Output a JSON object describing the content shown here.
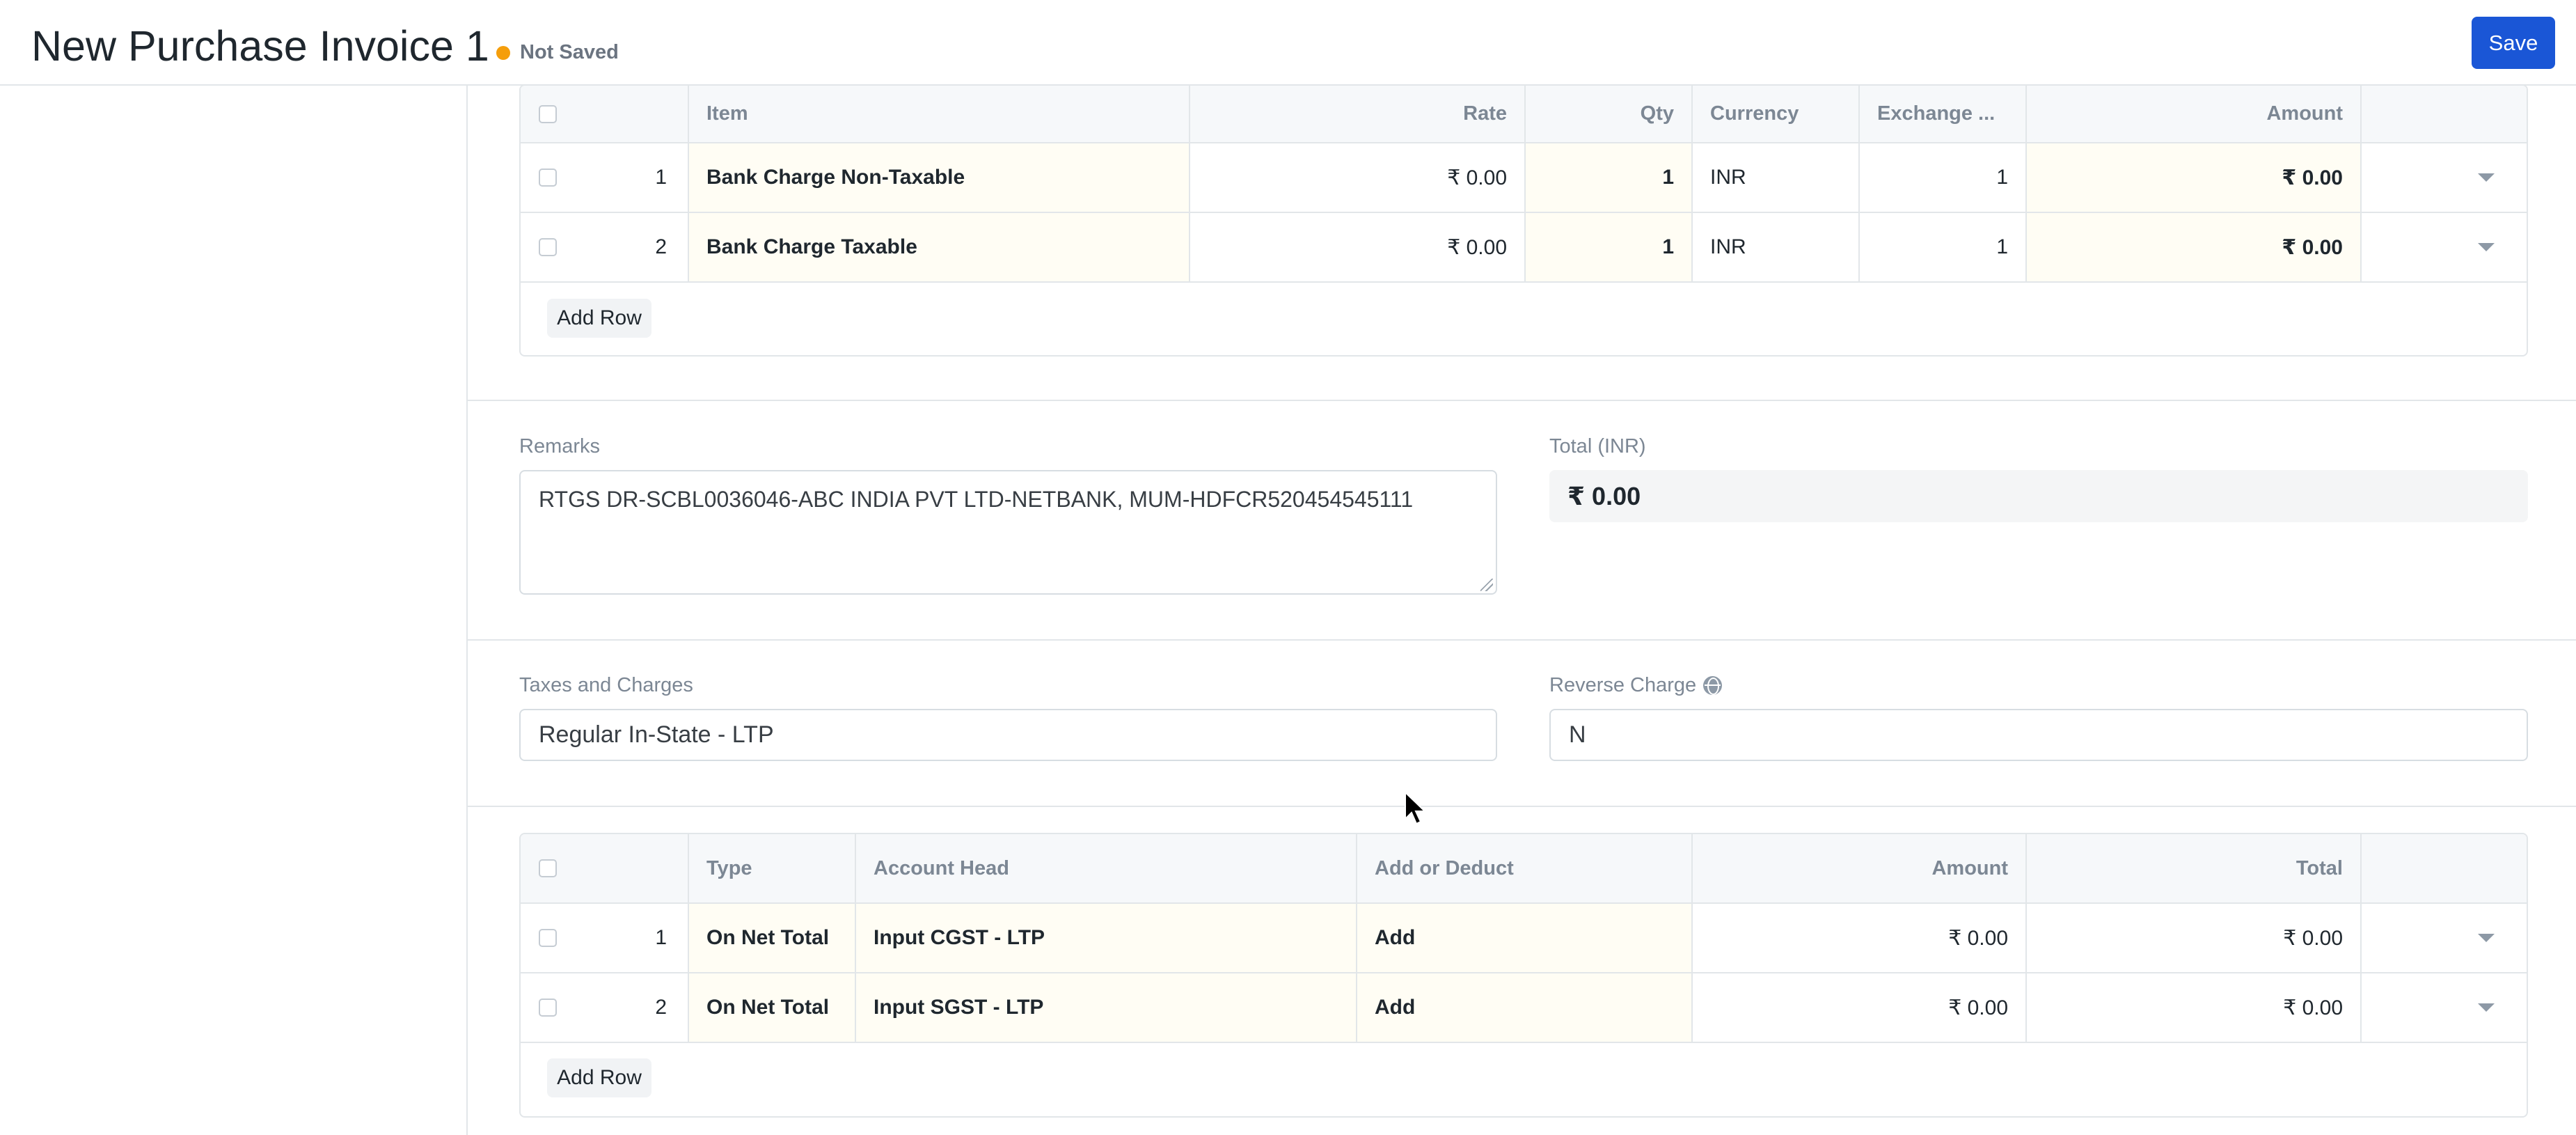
{
  "header": {
    "title": "New Purchase Invoice 1",
    "status": "Not Saved",
    "save_label": "Save"
  },
  "items_table": {
    "columns": [
      "Item",
      "Rate",
      "Qty",
      "Currency",
      "Exchange ...",
      "Amount"
    ],
    "rows": [
      {
        "idx": "1",
        "item": "Bank Charge Non-Taxable",
        "rate": "₹ 0.00",
        "qty": "1",
        "currency": "INR",
        "exchange": "1",
        "amount": "₹ 0.00"
      },
      {
        "idx": "2",
        "item": "Bank Charge Taxable",
        "rate": "₹ 0.00",
        "qty": "1",
        "currency": "INR",
        "exchange": "1",
        "amount": "₹ 0.00"
      }
    ],
    "add_row_label": "Add Row"
  },
  "remarks": {
    "label": "Remarks",
    "value": "RTGS DR-SCBL0036046-ABC INDIA PVT LTD-NETBANK, MUM-HDFCR520454545111"
  },
  "total": {
    "label": "Total (INR)",
    "value": "₹ 0.00"
  },
  "taxes_template": {
    "label": "Taxes and Charges",
    "value": "Regular In-State - LTP"
  },
  "reverse_charge": {
    "label": "Reverse Charge",
    "value": "N",
    "icon": "globe-icon"
  },
  "taxes_table": {
    "columns": [
      "Type",
      "Account Head",
      "Add or Deduct",
      "Amount",
      "Total"
    ],
    "rows": [
      {
        "idx": "1",
        "type": "On Net Total",
        "account_head": "Input CGST - LTP",
        "add_deduct": "Add",
        "amount": "₹ 0.00",
        "total": "₹ 0.00"
      },
      {
        "idx": "2",
        "type": "On Net Total",
        "account_head": "Input SGST - LTP",
        "add_deduct": "Add",
        "amount": "₹ 0.00",
        "total": "₹ 0.00"
      }
    ],
    "add_row_label": "Add Row"
  },
  "colors": {
    "primary": "#1a56d6",
    "status_dot": "#f59e0b",
    "highlight_cell": "#fffdf4"
  }
}
